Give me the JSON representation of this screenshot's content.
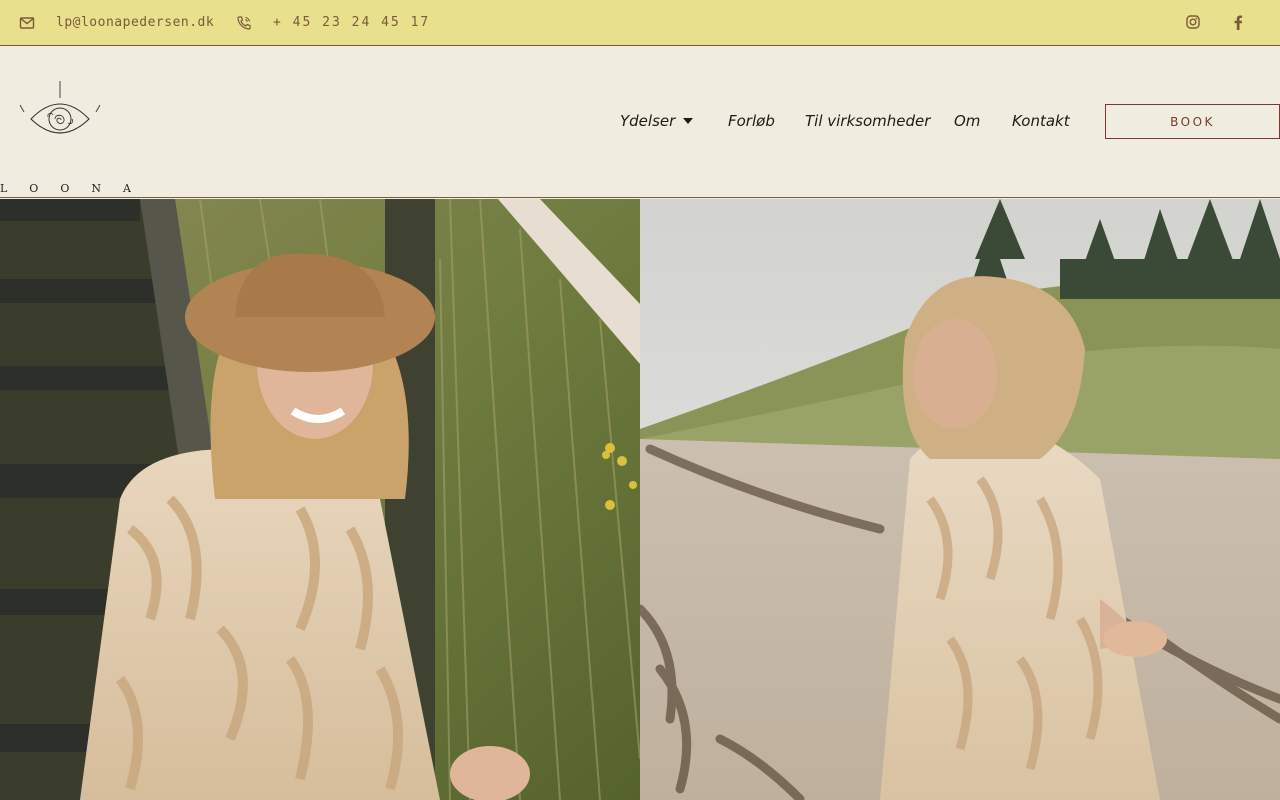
{
  "topbar": {
    "email": "lp@loonapedersen.dk",
    "phone": "+ 45 23 24 45 17",
    "icons": [
      "envelope-icon",
      "phone-icon",
      "instagram-icon",
      "facebook-icon"
    ]
  },
  "header": {
    "logo_text": "LOONA",
    "nav": {
      "ydelser": "Ydelser",
      "forlob": "Forløb",
      "virksomheder": "Til virksomheder",
      "om": "Om",
      "kontakt": "Kontakt"
    },
    "book_label": "BOOK"
  },
  "colors": {
    "topbar_bg": "#e9e08e",
    "header_bg": "#f0ecdf",
    "accent": "#7a3a2a",
    "text": "#1f1a14"
  }
}
